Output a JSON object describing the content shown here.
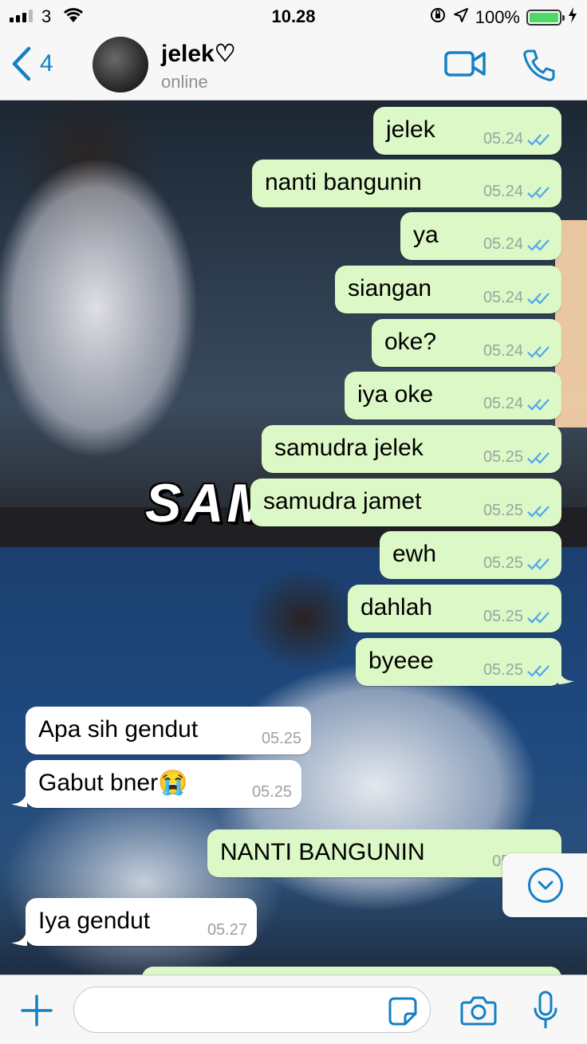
{
  "status_bar": {
    "carrier": "3",
    "time": "10.28",
    "battery": "100%",
    "battery_level": 1.0
  },
  "header": {
    "back_count": "4",
    "contact_name": "jelek♡",
    "contact_status": "online"
  },
  "wallpaper": {
    "overlay_text": "SAM"
  },
  "messages": [
    {
      "dir": "out",
      "text": "jelek",
      "time": "05.24",
      "status": "read"
    },
    {
      "dir": "out",
      "text": "nanti bangunin",
      "time": "05.24",
      "status": "read"
    },
    {
      "dir": "out",
      "text": "ya",
      "time": "05.24",
      "status": "read"
    },
    {
      "dir": "out",
      "text": "siangan",
      "time": "05.24",
      "status": "read"
    },
    {
      "dir": "out",
      "text": "oke?",
      "time": "05.24",
      "status": "read"
    },
    {
      "dir": "out",
      "text": "iya oke",
      "time": "05.24",
      "status": "read"
    },
    {
      "dir": "out",
      "text": "samudra jelek",
      "time": "05.25",
      "status": "read"
    },
    {
      "dir": "out",
      "text": "samudra jamet",
      "time": "05.25",
      "status": "read"
    },
    {
      "dir": "out",
      "text": "ewh",
      "time": "05.25",
      "status": "read"
    },
    {
      "dir": "out",
      "text": "dahlah",
      "time": "05.25",
      "status": "read"
    },
    {
      "dir": "out",
      "text": "byeee",
      "time": "05.25",
      "status": "read"
    },
    {
      "dir": "in",
      "text": "Apa sih gendut",
      "time": "05.25"
    },
    {
      "dir": "in",
      "text": "Gabut bner😭",
      "time": "05.25"
    },
    {
      "dir": "out",
      "text": "NANTI BANGUNIN",
      "time": "05.2",
      "status": "read"
    },
    {
      "dir": "in",
      "text": "Iya gendut",
      "time": "05.27"
    }
  ],
  "input": {
    "placeholder": ""
  },
  "colors": {
    "accent": "#1480c4",
    "outgoing_bubble": "#dcf8c6",
    "incoming_bubble": "#ffffff",
    "read_ticks": "#4fa8e8"
  },
  "icons": [
    "back-chevron-icon",
    "video-call-icon",
    "phone-icon",
    "tick-icon",
    "chevron-down-icon",
    "plus-icon",
    "sticker-icon",
    "camera-icon",
    "microphone-icon"
  ]
}
